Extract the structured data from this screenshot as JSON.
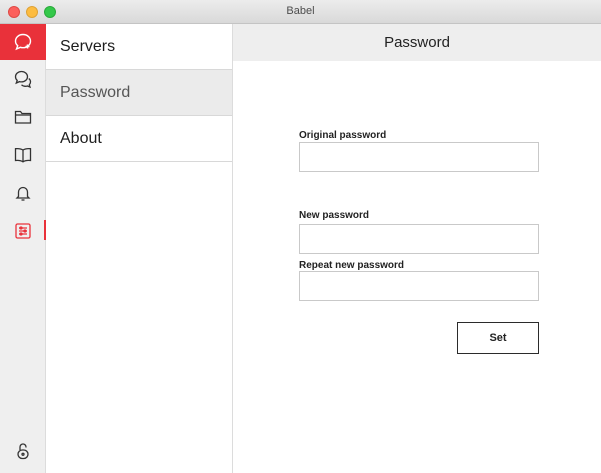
{
  "window": {
    "title": "Babel"
  },
  "iconbar": {
    "accent_color": "#e9313a",
    "items": [
      {
        "icon": "new-chat-icon"
      },
      {
        "icon": "chats-icon"
      },
      {
        "icon": "folder-icon"
      },
      {
        "icon": "book-icon"
      },
      {
        "icon": "bell-icon"
      },
      {
        "icon": "settings-icon",
        "active": true
      }
    ],
    "bottom_icon": "unlock-icon"
  },
  "submenu": {
    "items": [
      {
        "label": "Servers"
      },
      {
        "label": "Password",
        "active": true
      },
      {
        "label": "About"
      }
    ]
  },
  "main": {
    "title": "Password",
    "form": {
      "original_label": "Original password",
      "original_value": "",
      "new_label": "New password",
      "new_value": "",
      "repeat_label": "Repeat new password",
      "repeat_value": "",
      "submit_label": "Set"
    }
  }
}
